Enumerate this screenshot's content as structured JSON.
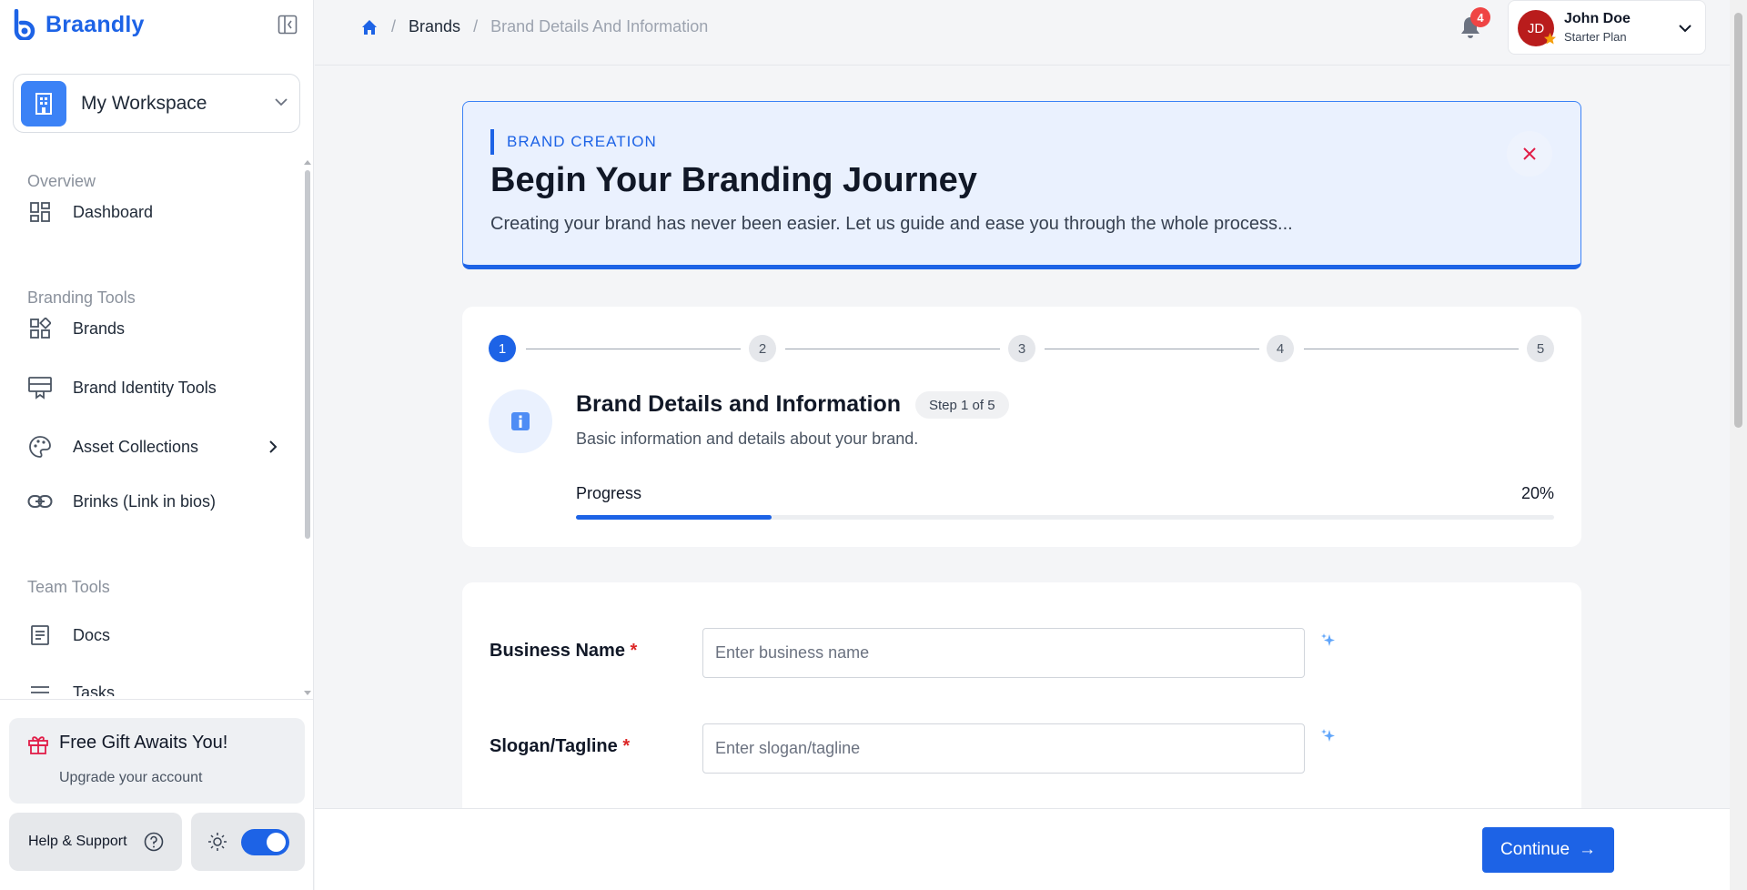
{
  "app": {
    "name": "Braandly",
    "brand_color": "#1d63e6"
  },
  "sidebar": {
    "workspace_label": "My Workspace",
    "sections": [
      {
        "title": "Overview",
        "items": [
          {
            "label": "Dashboard",
            "icon": "dashboard-icon"
          }
        ]
      },
      {
        "title": "Branding Tools",
        "items": [
          {
            "label": "Brands",
            "icon": "brands-icon"
          },
          {
            "label": "Brand Identity Tools",
            "icon": "identity-icon"
          },
          {
            "label": "Asset Collections",
            "icon": "palette-icon"
          },
          {
            "label": "Brinks (Link in bios)",
            "icon": "link-icon"
          }
        ]
      },
      {
        "title": "Team Tools",
        "items": [
          {
            "label": "Docs",
            "icon": "docs-icon"
          },
          {
            "label": "Tasks",
            "icon": "tasks-icon"
          }
        ]
      }
    ],
    "gift": {
      "title": "Free Gift Awaits You!",
      "subtitle": "Upgrade your account"
    },
    "help_label": "Help & Support",
    "theme_toggle_on": true
  },
  "topbar": {
    "breadcrumb": {
      "parent": "Brands",
      "current": "Brand Details And Information"
    },
    "notifications_count": "4",
    "user": {
      "initials": "JD",
      "name": "John Doe",
      "plan": "Starter Plan"
    }
  },
  "hero": {
    "tag": "BRAND CREATION",
    "title": "Begin Your Branding Journey",
    "description": "Creating your brand has never been easier. Let us guide and ease you through the whole process..."
  },
  "stepper": {
    "steps": [
      "1",
      "2",
      "3",
      "4",
      "5"
    ],
    "active_step": 1,
    "title": "Brand Details and Information",
    "step_label": "Step 1 of 5",
    "description": "Basic information and details about your brand.",
    "progress_label": "Progress",
    "progress_text": "20%",
    "progress_fraction": 0.2
  },
  "form": {
    "business_name": {
      "label": "Business Name",
      "required_mark": "*",
      "placeholder": "Enter business name",
      "value": ""
    },
    "slogan": {
      "label": "Slogan/Tagline",
      "required_mark": "*",
      "placeholder": "Enter slogan/tagline",
      "value": ""
    }
  },
  "footer": {
    "continue_label": "Continue",
    "continue_arrow": "→"
  }
}
